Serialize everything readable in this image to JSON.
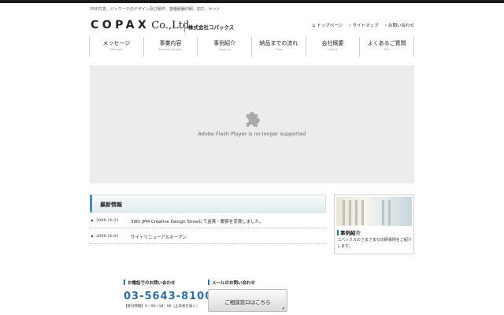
{
  "header": {
    "tagline": "POP広告、パッケージのデザイン及び製作、各種紙器印刷、加工、セット",
    "logo_main": "COPAX",
    "logo_co": "Co.,Ltd.",
    "company_name": "株式会社コパックス"
  },
  "utility_links": [
    {
      "icon": "home-icon",
      "label": "トップページ"
    },
    {
      "icon": "chevron-right-icon",
      "label": "サイトマップ"
    },
    {
      "icon": "chevron-right-icon",
      "label": "お問い合わせ"
    }
  ],
  "nav": [
    {
      "label": "メッセージ",
      "sub": "Message"
    },
    {
      "label": "事業内容",
      "sub": "Business Domain"
    },
    {
      "label": "事例紹介",
      "sub": "Features"
    },
    {
      "label": "納品までの流れ",
      "sub": "Flow"
    },
    {
      "label": "会社概要",
      "sub": "Outline"
    },
    {
      "label": "よくあるご質問",
      "sub": "FAQ"
    }
  ],
  "flash": {
    "icon": "puzzle-plugin-icon",
    "message": "Adobe Flash Player is no longer supported"
  },
  "news": {
    "heading": "最新情報",
    "items": [
      {
        "date": "2009.10.21",
        "text": "39th JPM Creative Design Showにて金賞・銀賞を受賞しました。"
      },
      {
        "date": "2009.10.01",
        "text": "サイトリニューアルオープン"
      }
    ]
  },
  "case_study": {
    "title": "事例紹介",
    "description": "コパックスのさまざまな印刷事例をご紹介します。"
  },
  "contact": {
    "phone_label": "お電話でのお問い合わせ",
    "phone": "03-5643-8100",
    "hours": "【受付時間】9：00～18：00（土日祝を除く）",
    "mail_label": "メールのお問い合わせ",
    "button_label": "ご相談窓口はこちら"
  },
  "colors": {
    "accent": "#2c6fa3",
    "topbar": "#1a1a1a",
    "flash_bg": "#ececec"
  }
}
